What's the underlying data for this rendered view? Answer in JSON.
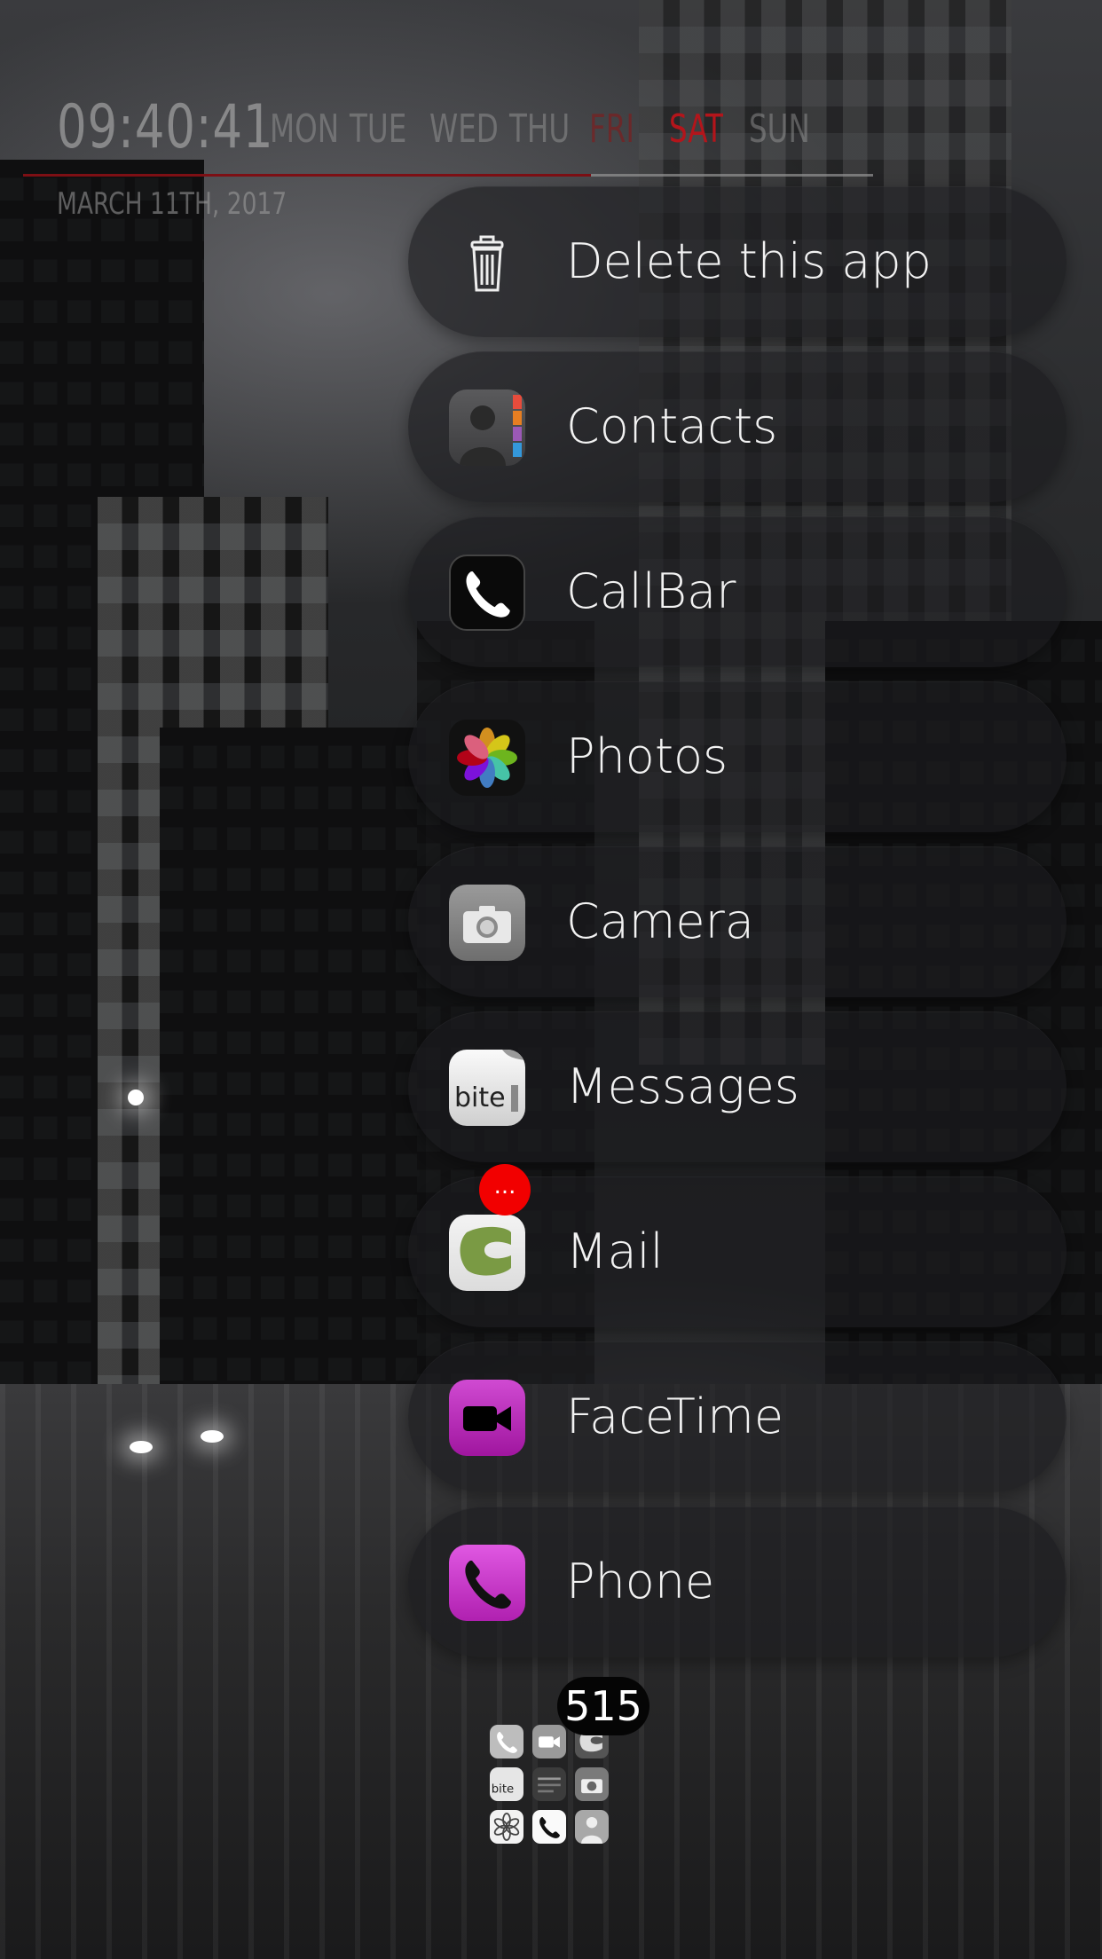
{
  "clock": {
    "time": "09:40:41",
    "days": [
      "MON",
      "TUE",
      "WED",
      "THU",
      "FRI",
      "SAT",
      "SUN"
    ],
    "active_day": "SAT",
    "date": "MARCH 11TH, 2017",
    "accent_color": "#b3151b"
  },
  "menu": {
    "items": [
      {
        "label": "Delete this app",
        "icon": "trash-icon"
      },
      {
        "label": "Contacts",
        "icon": "contacts-icon"
      },
      {
        "label": "CallBar",
        "icon": "callbar-icon"
      },
      {
        "label": "Photos",
        "icon": "photos-icon"
      },
      {
        "label": "Camera",
        "icon": "camera-icon"
      },
      {
        "label": "Messages",
        "icon": "messages-icon"
      },
      {
        "label": "Mail",
        "icon": "mail-icon",
        "badge": "..."
      },
      {
        "label": "FaceTime",
        "icon": "facetime-icon"
      },
      {
        "label": "Phone",
        "icon": "phone-icon"
      }
    ]
  },
  "folder": {
    "count": "515",
    "mini_icons": [
      "phone-icon",
      "facetime-icon",
      "mail-icon",
      "messages-icon",
      "notes-icon",
      "camera-icon",
      "photos-icon",
      "callbar-icon",
      "contacts-icon"
    ],
    "mini_text": "bite"
  },
  "colors": {
    "badge": "#f20000",
    "facetime": "#c030c2",
    "phone": "#d040d2"
  }
}
